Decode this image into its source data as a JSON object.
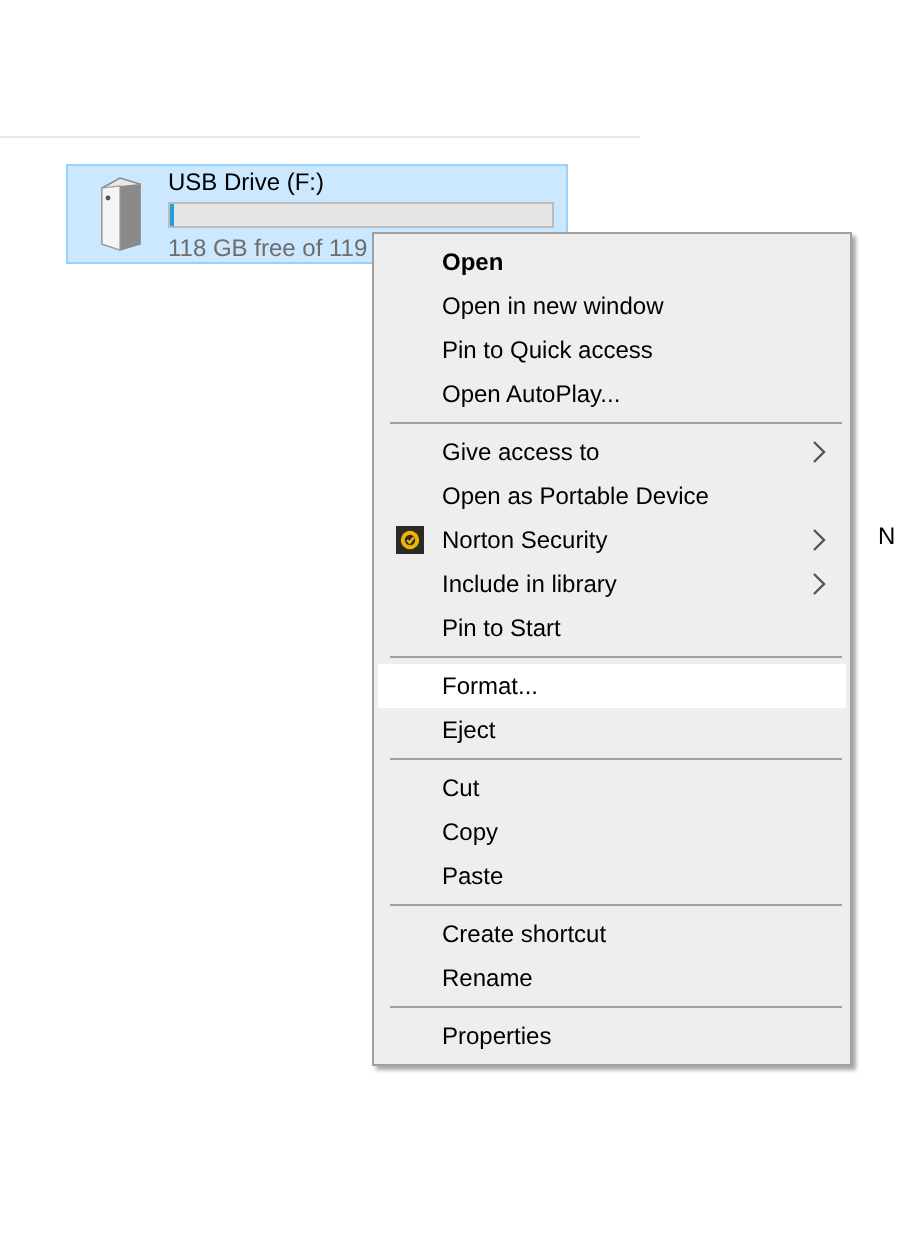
{
  "drive": {
    "name": "USB Drive (F:)",
    "level": 0.01,
    "free_space": "118 GB free of 119",
    "selected": true
  },
  "edge_text": "N",
  "context_menu": [
    {
      "kind": "item",
      "label": "Open",
      "default": true,
      "submenu": false,
      "selected": false
    },
    {
      "kind": "item",
      "label": "Open in new window",
      "default": false,
      "submenu": false,
      "selected": false
    },
    {
      "kind": "item",
      "label": "Pin to Quick access",
      "default": false,
      "submenu": false,
      "selected": false
    },
    {
      "kind": "item",
      "label": "Open AutoPlay...",
      "default": false,
      "submenu": false,
      "selected": false
    },
    {
      "kind": "separator"
    },
    {
      "kind": "item",
      "label": "Give access to",
      "default": false,
      "submenu": true,
      "selected": false
    },
    {
      "kind": "item",
      "label": "Open as Portable Device",
      "default": false,
      "submenu": false,
      "selected": false
    },
    {
      "kind": "icon-item",
      "label": "Norton Security",
      "default": false,
      "submenu": true,
      "selected": false
    },
    {
      "kind": "item",
      "label": "Include in library",
      "default": false,
      "submenu": true,
      "selected": false
    },
    {
      "kind": "item",
      "label": "Pin to Start",
      "default": false,
      "submenu": false,
      "selected": false
    },
    {
      "kind": "separator"
    },
    {
      "kind": "item",
      "label": "Format...",
      "default": false,
      "submenu": false,
      "selected": true
    },
    {
      "kind": "item",
      "label": "Eject",
      "default": false,
      "submenu": false,
      "selected": false
    },
    {
      "kind": "separator"
    },
    {
      "kind": "item",
      "label": "Cut",
      "default": false,
      "submenu": false,
      "selected": false
    },
    {
      "kind": "item",
      "label": "Copy",
      "default": false,
      "submenu": false,
      "selected": false
    },
    {
      "kind": "item",
      "label": "Paste",
      "default": false,
      "submenu": false,
      "selected": false
    },
    {
      "kind": "separator"
    },
    {
      "kind": "item",
      "label": "Create shortcut",
      "default": false,
      "submenu": false,
      "selected": false
    },
    {
      "kind": "item",
      "label": "Rename",
      "default": false,
      "submenu": false,
      "selected": false
    },
    {
      "kind": "separator"
    },
    {
      "kind": "item",
      "label": "Properties",
      "default": false,
      "submenu": false,
      "selected": false
    }
  ]
}
